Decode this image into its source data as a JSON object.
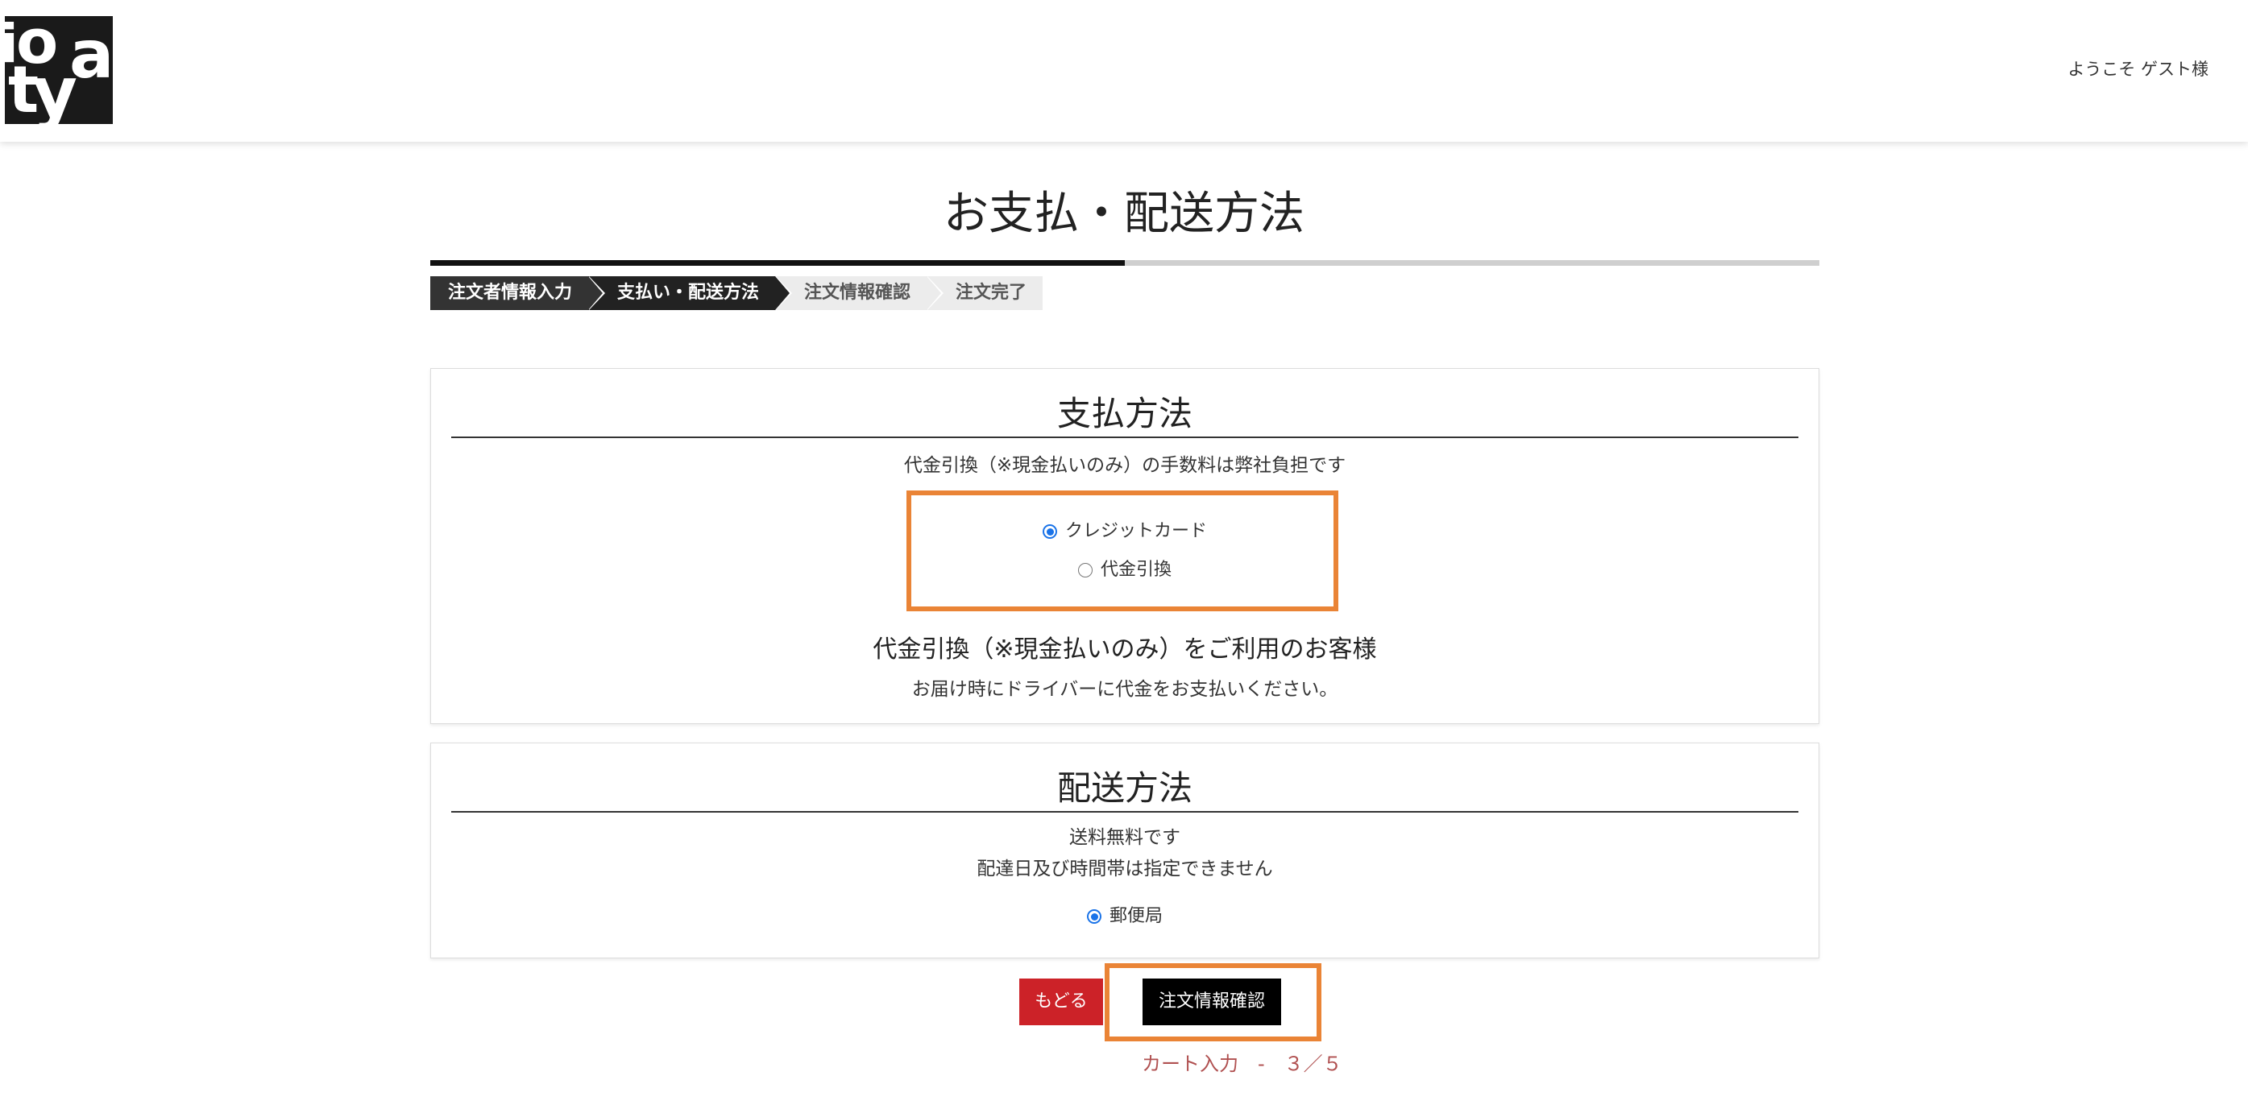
{
  "header": {
    "logo_letters": [
      "i",
      "o",
      "a",
      "t",
      "y"
    ],
    "welcome_text": "ようこそ ゲスト様"
  },
  "page": {
    "title": "お支払・配送方法",
    "progress_percent": 50
  },
  "steps": [
    {
      "label": "注文者情報入力",
      "state": "done"
    },
    {
      "label": "支払い・配送方法",
      "state": "current"
    },
    {
      "label": "注文情報確認",
      "state": "todo"
    },
    {
      "label": "注文完了",
      "state": "todo"
    }
  ],
  "payment": {
    "heading": "支払方法",
    "note": "代金引換（※現金払いのみ）の手数料は弊社負担です",
    "options": [
      {
        "label": "クレジットカード",
        "checked": true
      },
      {
        "label": "代金引換",
        "checked": false
      }
    ],
    "cod_heading": "代金引換（※現金払いのみ）をご利用のお客様",
    "cod_description": "お届け時にドライバーに代金をお支払いください。"
  },
  "shipping": {
    "heading": "配送方法",
    "note1": "送料無料です",
    "note2": "配達日及び時間帯は指定できません",
    "options": [
      {
        "label": "郵便局",
        "checked": true
      }
    ]
  },
  "actions": {
    "back_label": "もどる",
    "confirm_label": "注文情報確認",
    "cart_step_text": "カート入力　-　３／５"
  },
  "colors": {
    "highlight": "#ea8436",
    "back_button": "#cc2228",
    "confirm_button": "#000000",
    "radio_checked": "#1a73e8",
    "cart_step_text": "#b05050"
  }
}
